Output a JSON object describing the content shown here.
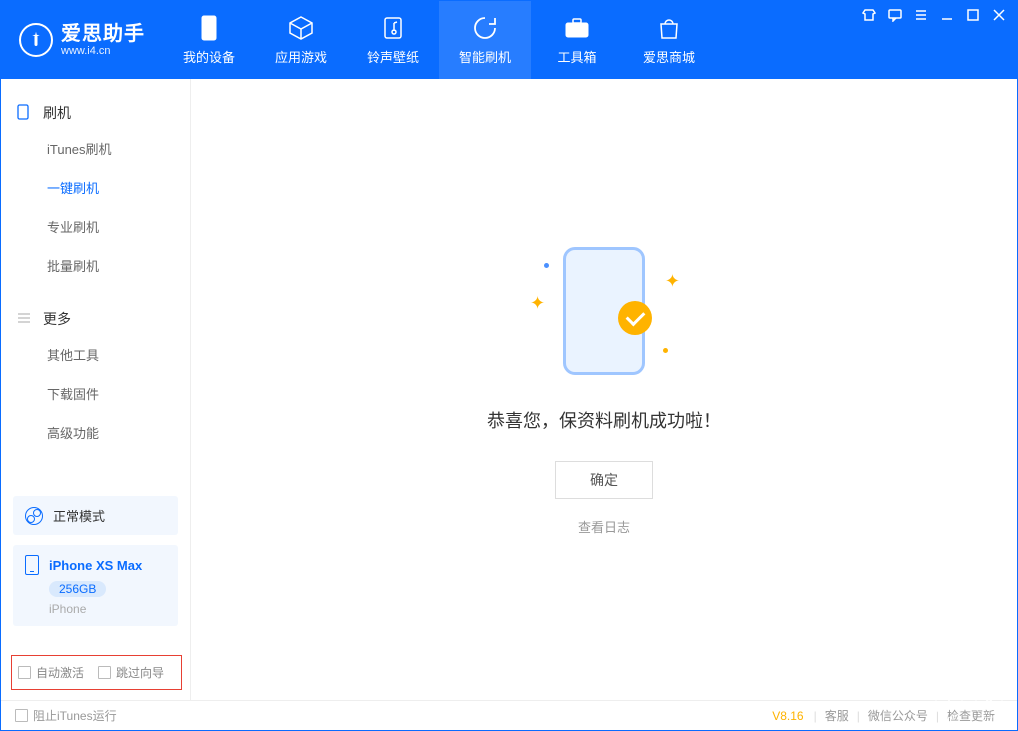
{
  "brand": {
    "name": "爱思助手",
    "url": "www.i4.cn"
  },
  "nav": {
    "items": [
      {
        "label": "我的设备"
      },
      {
        "label": "应用游戏"
      },
      {
        "label": "铃声壁纸"
      },
      {
        "label": "智能刷机"
      },
      {
        "label": "工具箱"
      },
      {
        "label": "爱思商城"
      }
    ],
    "active_index": 3
  },
  "sidebar": {
    "groups": [
      {
        "title": "刷机",
        "items": [
          {
            "label": "iTunes刷机"
          },
          {
            "label": "一键刷机"
          },
          {
            "label": "专业刷机"
          },
          {
            "label": "批量刷机"
          }
        ],
        "active_index": 1
      },
      {
        "title": "更多",
        "items": [
          {
            "label": "其他工具"
          },
          {
            "label": "下载固件"
          },
          {
            "label": "高级功能"
          }
        ]
      }
    ],
    "mode_label": "正常模式",
    "device": {
      "name": "iPhone XS Max",
      "capacity": "256GB",
      "type": "iPhone"
    },
    "options": [
      {
        "label": "自动激活",
        "checked": false
      },
      {
        "label": "跳过向导",
        "checked": false
      }
    ]
  },
  "main": {
    "success_message": "恭喜您，保资料刷机成功啦！",
    "confirm_label": "确定",
    "log_link": "查看日志"
  },
  "footer": {
    "block_itunes": "阻止iTunes运行",
    "version": "V8.16",
    "links": [
      "客服",
      "微信公众号",
      "检查更新"
    ]
  }
}
